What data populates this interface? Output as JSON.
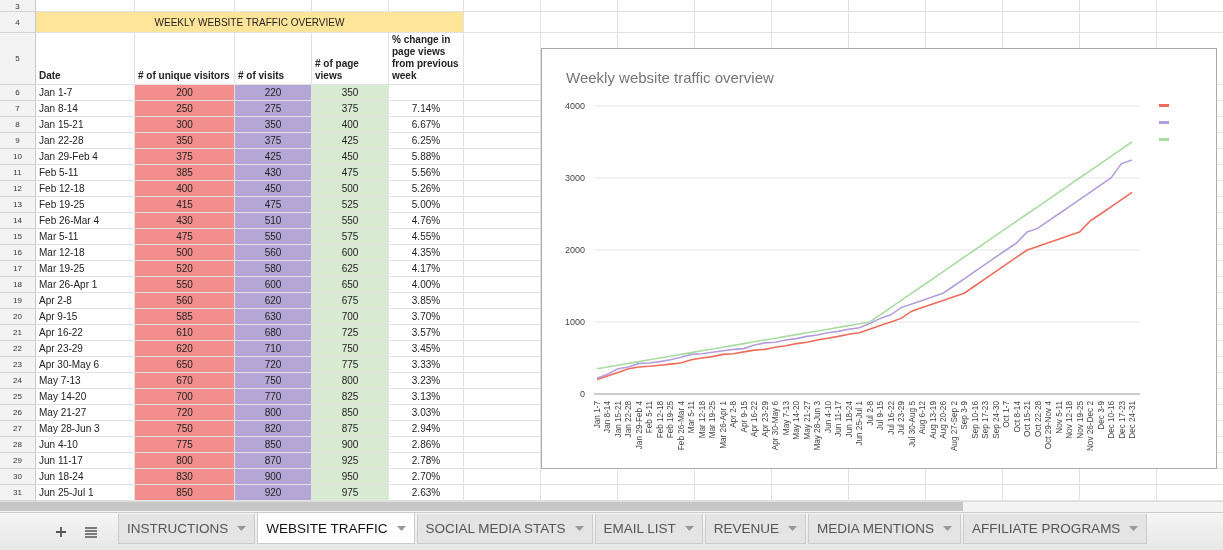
{
  "sheet": {
    "empty_row_number": "3",
    "title_row_number": "4",
    "title": "WEEKLY WEBSITE TRAFFIC OVERVIEW",
    "header_row_number": "5",
    "columns": [
      "Date",
      "# of unique visitors",
      "# of visits",
      "# of page views",
      "% change in page views from previous week"
    ],
    "rows": [
      {
        "num": "6",
        "date": "Jan 1-7",
        "visitors": "200",
        "visits": "220",
        "page_views": "350"
      },
      {
        "num": "7",
        "date": "Jan 8-14",
        "visitors": "250",
        "visits": "275",
        "page_views": "375",
        "change": "7.14%"
      },
      {
        "num": "8",
        "date": "Jan 15-21",
        "visitors": "300",
        "visits": "350",
        "page_views": "400",
        "change": "6.67%"
      },
      {
        "num": "9",
        "date": "Jan 22-28",
        "visitors": "350",
        "visits": "375",
        "page_views": "425",
        "change": "6.25%"
      },
      {
        "num": "10",
        "date": "Jan 29-Feb 4",
        "visitors": "375",
        "visits": "425",
        "page_views": "450",
        "change": "5.88%"
      },
      {
        "num": "11",
        "date": "Feb 5-11",
        "visitors": "385",
        "visits": "430",
        "page_views": "475",
        "change": "5.56%"
      },
      {
        "num": "12",
        "date": "Feb 12-18",
        "visitors": "400",
        "visits": "450",
        "page_views": "500",
        "change": "5.26%"
      },
      {
        "num": "13",
        "date": "Feb 19-25",
        "visitors": "415",
        "visits": "475",
        "page_views": "525",
        "change": "5.00%"
      },
      {
        "num": "14",
        "date": "Feb 26-Mar 4",
        "visitors": "430",
        "visits": "510",
        "page_views": "550",
        "change": "4.76%"
      },
      {
        "num": "15",
        "date": "Mar 5-11",
        "visitors": "475",
        "visits": "550",
        "page_views": "575",
        "change": "4.55%"
      },
      {
        "num": "16",
        "date": "Mar 12-18",
        "visitors": "500",
        "visits": "560",
        "page_views": "600",
        "change": "4.35%"
      },
      {
        "num": "17",
        "date": "Mar 19-25",
        "visitors": "520",
        "visits": "580",
        "page_views": "625",
        "change": "4.17%"
      },
      {
        "num": "18",
        "date": "Mar 26-Apr 1",
        "visitors": "550",
        "visits": "600",
        "page_views": "650",
        "change": "4.00%"
      },
      {
        "num": "19",
        "date": "Apr 2-8",
        "visitors": "560",
        "visits": "620",
        "page_views": "675",
        "change": "3.85%"
      },
      {
        "num": "20",
        "date": "Apr 9-15",
        "visitors": "585",
        "visits": "630",
        "page_views": "700",
        "change": "3.70%"
      },
      {
        "num": "21",
        "date": "Apr 16-22",
        "visitors": "610",
        "visits": "680",
        "page_views": "725",
        "change": "3.57%"
      },
      {
        "num": "22",
        "date": "Apr 23-29",
        "visitors": "620",
        "visits": "710",
        "page_views": "750",
        "change": "3.45%"
      },
      {
        "num": "23",
        "date": "Apr 30-May 6",
        "visitors": "650",
        "visits": "720",
        "page_views": "775",
        "change": "3.33%"
      },
      {
        "num": "24",
        "date": "May 7-13",
        "visitors": "670",
        "visits": "750",
        "page_views": "800",
        "change": "3.23%"
      },
      {
        "num": "25",
        "date": "May 14-20",
        "visitors": "700",
        "visits": "770",
        "page_views": "825",
        "change": "3.13%"
      },
      {
        "num": "26",
        "date": "May 21-27",
        "visitors": "720",
        "visits": "800",
        "page_views": "850",
        "change": "3.03%"
      },
      {
        "num": "27",
        "date": "May 28-Jun 3",
        "visitors": "750",
        "visits": "820",
        "page_views": "875",
        "change": "2.94%"
      },
      {
        "num": "28",
        "date": "Jun 4-10",
        "visitors": "775",
        "visits": "850",
        "page_views": "900",
        "change": "2.86%"
      },
      {
        "num": "29",
        "date": "Jun 11-17",
        "visitors": "800",
        "visits": "870",
        "page_views": "925",
        "change": "2.78%"
      },
      {
        "num": "30",
        "date": "Jun 18-24",
        "visitors": "830",
        "visits": "900",
        "page_views": "950",
        "change": "2.70%"
      },
      {
        "num": "31",
        "date": "Jun 25-Jul 1",
        "visitors": "850",
        "visits": "920",
        "page_views": "975",
        "change": "2.63%"
      }
    ],
    "chart": {
      "chart_data": {
        "type": "line",
        "title": "Weekly website traffic overview",
        "categories": [
          "Jan 1-7",
          "Jan 8-14",
          "Jan 15-21",
          "Jan 22-28",
          "Jan 29-Feb 4",
          "Feb 5-11",
          "Feb 12-18",
          "Feb 19-25",
          "Feb 26-Mar 4",
          "Mar 5-11",
          "Mar 12-18",
          "Mar 19-25",
          "Mar 26-Apr 1",
          "Apr 2-8",
          "Apr 9-15",
          "Apr 16-22",
          "Apr 23-29",
          "Apr 30-May 6",
          "May 7-13",
          "May 14-20",
          "May 21-27",
          "May 28-Jun 3",
          "Jun 4-10",
          "Jun 11-17",
          "Jun 18-24",
          "Jun 25-Jul 1",
          "Jul 2-8",
          "Jul 9-15",
          "Jul 16-22",
          "Jul 23-29",
          "Jul 30-Aug 5",
          "Aug 6-12",
          "Aug 13-19",
          "Aug 20-26",
          "Aug 27-Sep 2",
          "Sep 3-9",
          "Sep 10-16",
          "Sep 17-23",
          "Sep 24-30",
          "Oct 1-7",
          "Oct 8-14",
          "Oct 15-21",
          "Oct 22-28",
          "Oct 29-Nov 4",
          "Nov 5-11",
          "Nov 12-18",
          "Nov 19-25",
          "Nov 26-Dec 2",
          "Dec 3-9",
          "Dec 10-16",
          "Dec 17-23",
          "Dec 24-31"
        ],
        "series": [
          {
            "color": "#ef6c5b",
            "values": [
              200,
              250,
              300,
              350,
              375,
              385,
              400,
              415,
              430,
              475,
              500,
              520,
              550,
              560,
              585,
              610,
              620,
              650,
              670,
              700,
              720,
              750,
              775,
              800,
              830,
              850,
              900,
              950,
              1000,
              1050,
              1150,
              1200,
              1250,
              1300,
              1350,
              1400,
              1500,
              1600,
              1700,
              1800,
              1900,
              2000,
              2050,
              2100,
              2150,
              2200,
              2250,
              2400,
              2500,
              2600,
              2700,
              2800
            ]
          },
          {
            "color": "#b39ddb",
            "values": [
              220,
              275,
              350,
              375,
              425,
              430,
              450,
              475,
              510,
              550,
              560,
              580,
              600,
              620,
              630,
              680,
              710,
              720,
              750,
              770,
              800,
              820,
              850,
              870,
              900,
              920,
              980,
              1050,
              1100,
              1200,
              1250,
              1300,
              1350,
              1400,
              1500,
              1600,
              1700,
              1800,
              1900,
              2000,
              2100,
              2250,
              2300,
              2400,
              2500,
              2600,
              2700,
              2800,
              2900,
              3000,
              3200,
              3250
            ]
          },
          {
            "color": "#a8dca0",
            "values": [
              350,
              375,
              400,
              425,
              450,
              475,
              500,
              525,
              550,
              575,
              600,
              625,
              650,
              675,
              700,
              725,
              750,
              775,
              800,
              825,
              850,
              875,
              900,
              925,
              950,
              975,
              1000,
              1100,
              1200,
              1300,
              1400,
              1500,
              1600,
              1700,
              1800,
              1900,
              2000,
              2100,
              2200,
              2300,
              2400,
              2500,
              2600,
              2700,
              2800,
              2900,
              3000,
              3100,
              3200,
              3300,
              3400,
              3500
            ]
          }
        ],
        "grid": true,
        "ylim": [
          0,
          4000
        ],
        "yticks": [
          0,
          1000,
          2000,
          3000,
          4000
        ]
      }
    }
  },
  "tabs": [
    {
      "label": "INSTRUCTIONS",
      "selected": false
    },
    {
      "label": "WEBSITE TRAFFIC",
      "selected": true
    },
    {
      "label": "SOCIAL MEDIA STATS",
      "selected": false
    },
    {
      "label": "EMAIL LIST",
      "selected": false
    },
    {
      "label": "REVENUE",
      "selected": false
    },
    {
      "label": "MEDIA MENTIONS",
      "selected": false
    },
    {
      "label": "AFFILIATE PROGRAMS",
      "selected": false
    }
  ]
}
